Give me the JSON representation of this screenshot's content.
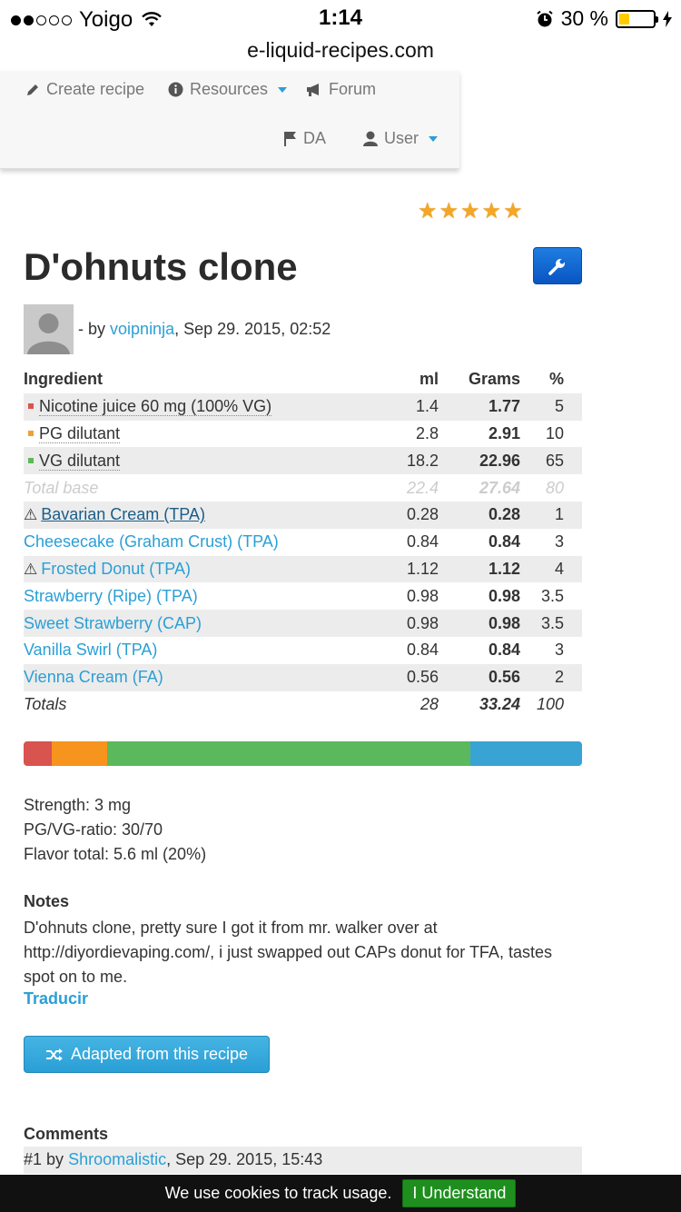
{
  "status_bar": {
    "carrier": "Yoigo",
    "time": "1:14",
    "battery": "30 %",
    "battery_level": 0.3
  },
  "url": "e-liquid-recipes.com",
  "nav": {
    "create_recipe": "Create recipe",
    "resources": "Resources",
    "forum": "Forum",
    "da": "DA",
    "user": "User"
  },
  "recipe": {
    "rating_stars": 5,
    "title": "D'ohnuts clone",
    "by_prefix": "- by",
    "author": "voipninja",
    "date": ", Sep 29. 2015, 02:52"
  },
  "table": {
    "headers": {
      "ingredient": "Ingredient",
      "ml": "ml",
      "grams": "Grams",
      "pct": "%"
    },
    "base_rows": [
      {
        "name": "Nicotine juice 60 mg (100% VG)",
        "color": "#d9534f",
        "ml": "1.4",
        "grams": "1.77",
        "pct": "5"
      },
      {
        "name": "PG dilutant",
        "color": "#f0a030",
        "ml": "2.8",
        "grams": "2.91",
        "pct": "10"
      },
      {
        "name": "VG dilutant",
        "color": "#5cb85c",
        "ml": "18.2",
        "grams": "22.96",
        "pct": "65"
      }
    ],
    "total_base": {
      "label": "Total base",
      "ml": "22.4",
      "grams": "27.64",
      "pct": "80"
    },
    "flavors": [
      {
        "name": "Bavarian Cream (TPA)",
        "warning": true,
        "ml": "0.28",
        "grams": "0.28",
        "pct": "1"
      },
      {
        "name": "Cheesecake (Graham Crust) (TPA)",
        "warning": false,
        "ml": "0.84",
        "grams": "0.84",
        "pct": "3"
      },
      {
        "name": "Frosted Donut (TPA)",
        "warning": true,
        "ml": "1.12",
        "grams": "1.12",
        "pct": "4"
      },
      {
        "name": "Strawberry (Ripe) (TPA)",
        "warning": false,
        "ml": "0.98",
        "grams": "0.98",
        "pct": "3.5"
      },
      {
        "name": "Sweet Strawberry (CAP)",
        "warning": false,
        "ml": "0.98",
        "grams": "0.98",
        "pct": "3.5"
      },
      {
        "name": "Vanilla Swirl (TPA)",
        "warning": false,
        "ml": "0.84",
        "grams": "0.84",
        "pct": "3"
      },
      {
        "name": "Vienna Cream (FA)",
        "warning": false,
        "ml": "0.56",
        "grams": "0.56",
        "pct": "2"
      }
    ],
    "totals": {
      "label": "Totals",
      "ml": "28",
      "grams": "33.24",
      "pct": "100"
    }
  },
  "composition_bar": [
    {
      "part": "nicotine",
      "percent": 5,
      "color": "#d9534f"
    },
    {
      "part": "pg",
      "percent": 10,
      "color": "#f7941d"
    },
    {
      "part": "vg",
      "percent": 65,
      "color": "#5cb85c"
    },
    {
      "part": "flavor",
      "percent": 20,
      "color": "#39a3d3"
    }
  ],
  "stats": {
    "strength": "Strength: 3 mg",
    "ratio": "PG/VG-ratio: 30/70",
    "flavor_total": "Flavor total: 5.6 ml (20%)"
  },
  "notes": {
    "heading": "Notes",
    "text": "D'ohnuts clone, pretty sure I got it from mr. walker over at http://diyordievaping.com/, i just swapped out CAPs donut for TFA, tastes spot on to me.",
    "translate": "Traducir"
  },
  "adapt_button": "Adapted from this recipe",
  "comments": {
    "heading": "Comments",
    "first_prefix": "#1 by",
    "first_author": "Shroomalistic",
    "first_date": ", Sep 29. 2015, 15:43"
  },
  "cookie": {
    "text": "We use cookies to track usage.",
    "button": "I Understand"
  }
}
